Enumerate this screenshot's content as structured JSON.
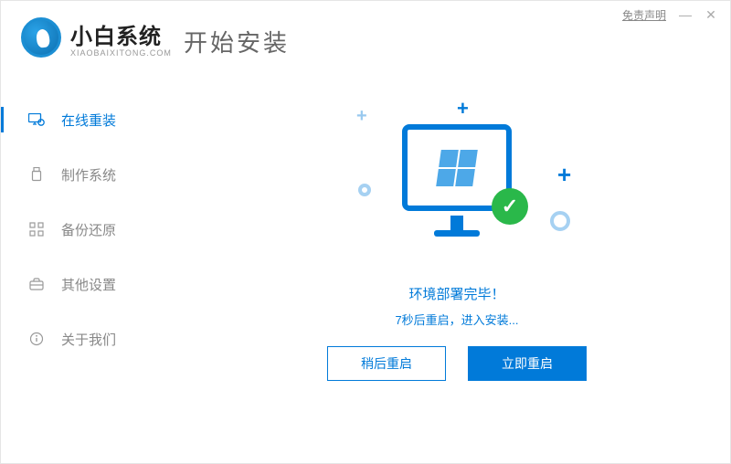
{
  "titlebar": {
    "disclaimer": "免责声明"
  },
  "brand": {
    "name": "小白系统",
    "url": "XIAOBAIXITONG.COM"
  },
  "page_title": "开始安装",
  "sidebar": {
    "items": [
      {
        "label": "在线重装"
      },
      {
        "label": "制作系统"
      },
      {
        "label": "备份还原"
      },
      {
        "label": "其他设置"
      },
      {
        "label": "关于我们"
      }
    ]
  },
  "status": {
    "line1": "环境部署完毕！",
    "line2": "7秒后重启，进入安装...",
    "countdown_seconds": 7
  },
  "buttons": {
    "later": "稍后重启",
    "now": "立即重启"
  }
}
